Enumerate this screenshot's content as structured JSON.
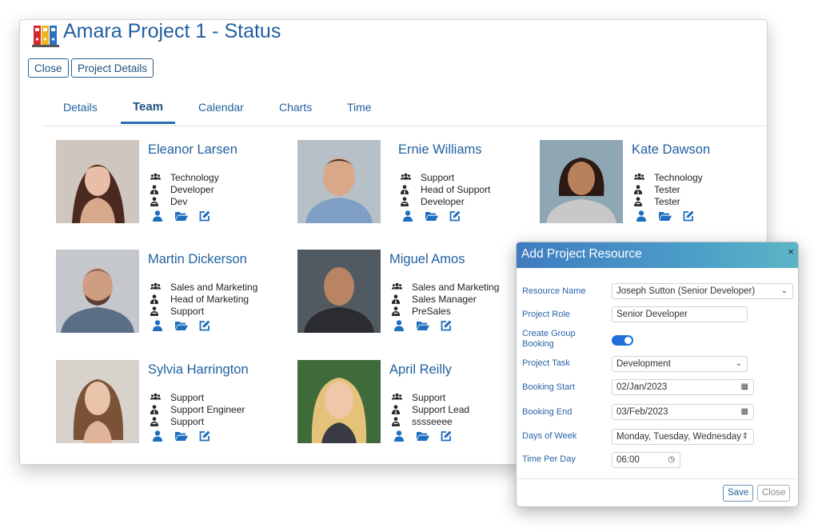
{
  "app": {
    "title": "Amara Project 1 - Status"
  },
  "toolbar": {
    "close_label": "Close",
    "details_label": "Project Details"
  },
  "tabs": [
    {
      "label": "Details"
    },
    {
      "label": "Team"
    },
    {
      "label": "Calendar"
    },
    {
      "label": "Charts"
    },
    {
      "label": "Time"
    }
  ],
  "active_tab": "Team",
  "team": [
    {
      "name": "Eleanor Larsen",
      "department": "Technology",
      "role": "Developer",
      "task": "Dev"
    },
    {
      "name": "Ernie Williams",
      "department": "Support",
      "role": "Head of Support",
      "task": "Developer"
    },
    {
      "name": "Kate Dawson",
      "department": "Technology",
      "role": "Tester",
      "task": "Tester"
    },
    {
      "name": "Martin Dickerson",
      "department": "Sales and Marketing",
      "role": "Head of Marketing",
      "task": "Support"
    },
    {
      "name": "Miguel Amos",
      "department": "Sales and Marketing",
      "role": "Sales Manager",
      "task": "PreSales"
    },
    {
      "name": "Sylvia Harrington",
      "department": "Support",
      "role": "Support Engineer",
      "task": "Support"
    },
    {
      "name": "April Reilly",
      "department": "Support",
      "role": "Support Lead",
      "task": "sssseeee"
    }
  ],
  "dialog": {
    "title": "Add Project Resource",
    "close_glyph": "×",
    "fields": {
      "resource_name": {
        "label": "Resource Name",
        "value": "Joseph Sutton (Senior Developer)"
      },
      "project_role": {
        "label": "Project Role",
        "value": "Senior Developer"
      },
      "group_booking": {
        "label_line1": "Create Group",
        "label_line2": "Booking",
        "checked": true
      },
      "project_task": {
        "label": "Project Task",
        "value": "Development"
      },
      "booking_start": {
        "label": "Booking Start",
        "value": "02/Jan/2023"
      },
      "booking_end": {
        "label": "Booking End",
        "value": "03/Feb/2023"
      },
      "days_of_week": {
        "label": "Days of Week",
        "value": "Monday, Tuesday, Wednesday"
      },
      "time_per_day": {
        "label": "Time Per Day",
        "value": "06:00"
      }
    },
    "save_label": "Save",
    "close_label": "Close"
  },
  "colors": {
    "accent": "#1f5f9f",
    "header_start": "#3f7cc0",
    "header_end": "#5bb5c6",
    "toggle": "#1e6fd9"
  },
  "icons": {
    "department": "users-icon",
    "role": "user-tie-icon",
    "task": "user-task-icon",
    "profile": "user-icon",
    "files": "folder-open-icon",
    "edit": "edit-icon"
  }
}
